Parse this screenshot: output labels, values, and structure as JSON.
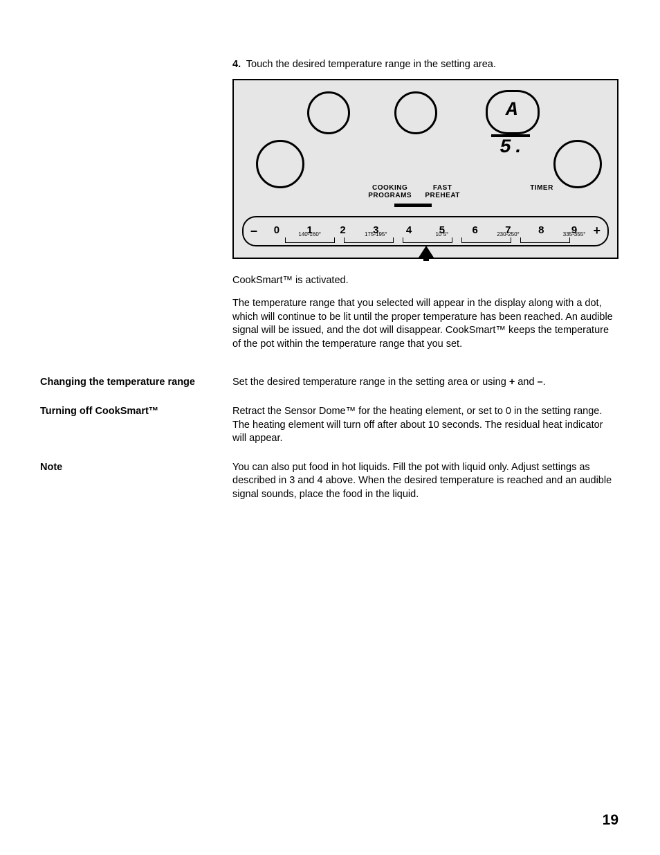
{
  "step": {
    "num": "4.",
    "text": "Touch the desired temperature range in the setting area."
  },
  "panel": {
    "display": "A 5.",
    "labels": {
      "cooking": "COOKING\nPROGRAMS",
      "fast": "FAST\nPREHEAT",
      "timer": "TIMER"
    },
    "minus": "–",
    "plus": "+",
    "slots": [
      {
        "n": "0"
      },
      {
        "n": "1",
        "t": "140-160°"
      },
      {
        "n": "2"
      },
      {
        "n": "3",
        "t": "175-195°"
      },
      {
        "n": "4"
      },
      {
        "n": "5",
        "t": "10   5°"
      },
      {
        "n": "6"
      },
      {
        "n": "7",
        "t": "230-250°"
      },
      {
        "n": "8"
      },
      {
        "n": "9",
        "t": "335-355°"
      }
    ]
  },
  "after": [
    "CookSmart™ is activated.",
    "The temperature range that you selected will appear in the display along with a dot, which will continue to be lit until the proper temperature has been reached. An audible signal will be issued, and the dot will disappear. CookSmart™ keeps the temperature of the pot within the temperature range that you set."
  ],
  "sections": [
    {
      "h": "Changing the temperature range",
      "p": [
        "Set the desired temperature range in the setting area or using + and –."
      ]
    },
    {
      "h": "Turning off CookSmart™",
      "p": [
        "Retract the Sensor Dome™ for the heating element, or set to 0 in the setting range. The heating element will turn off after about 10 seconds. The residual heat indicator will appear."
      ]
    },
    {
      "h": "Note",
      "p": [
        "You can also put food in hot liquids. Fill the pot with liquid only. Adjust settings as described in 3 and 4 above. When the desired temperature is reached and an audible signal sounds, place the food in the liquid."
      ]
    }
  ],
  "pageNumber": "19"
}
